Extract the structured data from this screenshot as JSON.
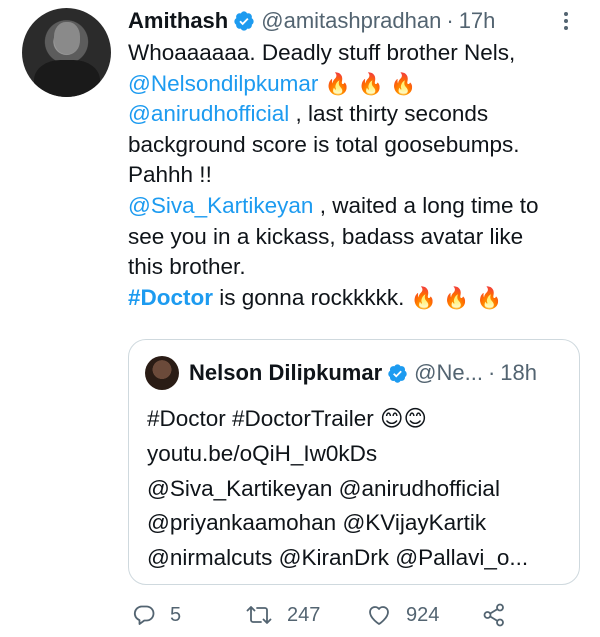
{
  "tweet": {
    "author_name": "Amithash",
    "author_handle": "@amitashpradhan",
    "separator": "·",
    "time": "17h",
    "text": {
      "l1": "Whoaaaaaa. Deadly stuff brother Nels,",
      "l2_mention": "@Nelsondilpkumar",
      "fire_emojis": "🔥 🔥 🔥",
      "l3_mention": "@anirudhofficial",
      "l3_rest": " , last thirty seconds",
      "l4": "background score is total goosebumps.",
      "l5": "Pahhh !!",
      "l6_mention": "@Siva_Kartikeyan",
      "l6_rest": " , waited a long time to",
      "l7": "see you in a kickass, badass avatar like",
      "l8": "this brother.",
      "l9_hashtag": "#Doctor",
      "l9_rest": " is gonna rockkkkk. "
    }
  },
  "quoted_tweet": {
    "author_name": "Nelson Dilipkumar",
    "author_handle": "@Ne...",
    "separator": "·",
    "time": "18h",
    "lines": {
      "l1": "#Doctor #DoctorTrailer 😊😊",
      "l2": "youtu.be/oQiH_Iw0kDs",
      "l3": "@Siva_Kartikeyan @anirudhofficial",
      "l4": "@priyankaamohan @KVijayKartik",
      "l5": "@nirmalcuts @KiranDrk @Pallavi_o..."
    }
  },
  "actions": {
    "reply_count": "5",
    "retweet_count": "247",
    "like_count": "924"
  },
  "colors": {
    "link": "#1d9bf0",
    "secondary_text": "#536471",
    "border": "#cfd9de"
  },
  "icons": [
    "verified-badge-icon",
    "more-options-icon",
    "reply-icon",
    "retweet-icon",
    "like-icon",
    "share-icon"
  ]
}
